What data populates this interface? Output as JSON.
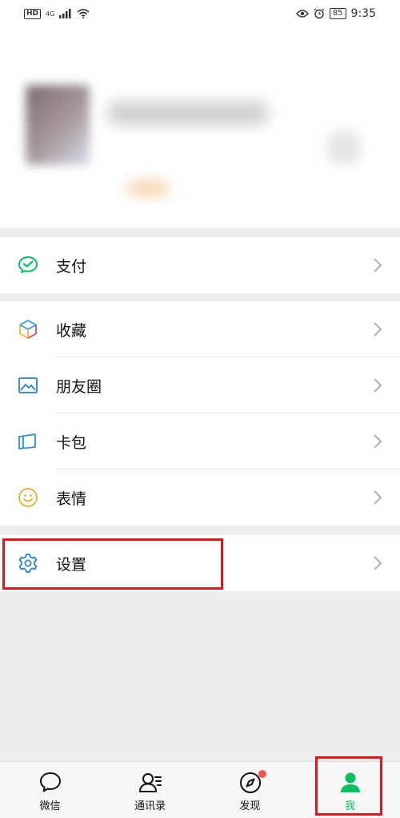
{
  "status_bar": {
    "hd": "HD",
    "network": "4G",
    "battery": "85",
    "time": "9:35"
  },
  "menu": {
    "pay": "支付",
    "favorites": "收藏",
    "moments": "朋友圈",
    "cards": "卡包",
    "stickers": "表情",
    "settings": "设置"
  },
  "tabbar": {
    "tabs": [
      {
        "label": "微信"
      },
      {
        "label": "通讯录"
      },
      {
        "label": "发现"
      },
      {
        "label": "我"
      }
    ]
  },
  "colors": {
    "accent_green": "#07c160",
    "highlight_red": "#e0161b",
    "badge_red": "#fa5151"
  },
  "icons": [
    "wechat-pay-icon",
    "favorites-cube-icon",
    "moments-picture-icon",
    "card-wallet-icon",
    "sticker-smile-icon",
    "settings-gear-icon",
    "chat-bubble-icon",
    "contacts-icon",
    "compass-icon",
    "me-person-icon"
  ]
}
